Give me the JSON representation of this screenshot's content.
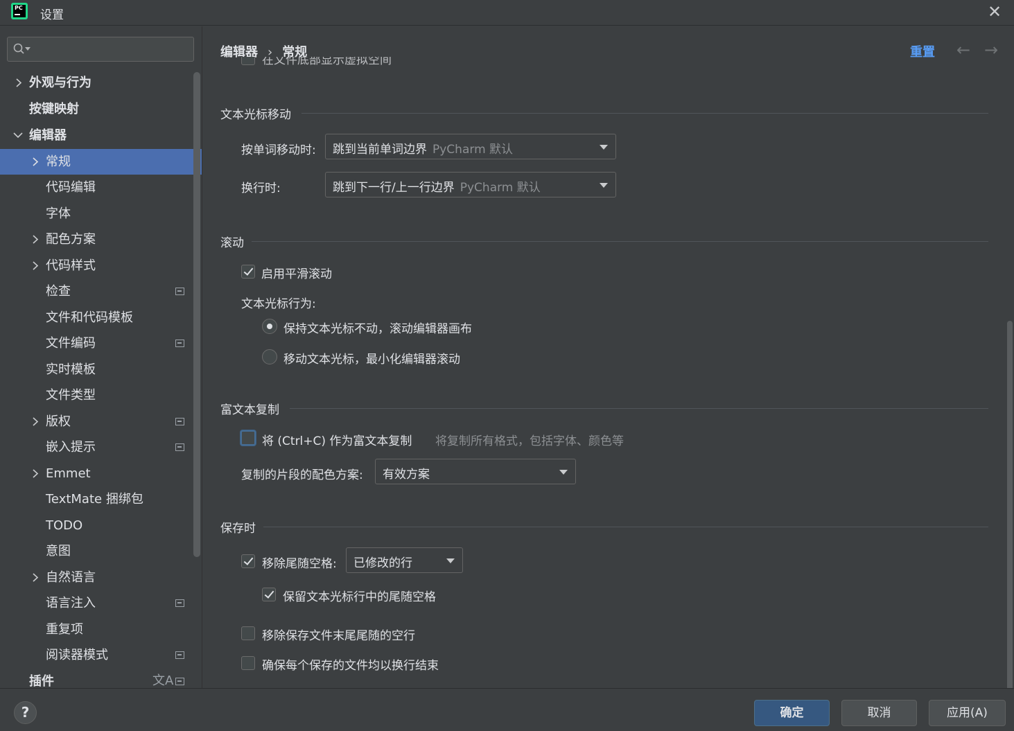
{
  "window": {
    "title": "设置",
    "close_glyph": "✕"
  },
  "sidebar": {
    "search": {
      "placeholder": ""
    },
    "items": [
      {
        "label": "外观与行为",
        "expanded": false,
        "bold": true
      },
      {
        "label": "按键映射",
        "bold": true
      },
      {
        "label": "编辑器",
        "expanded": true,
        "bold": true
      },
      {
        "label": "常规",
        "selected": true
      },
      {
        "label": "代码编辑"
      },
      {
        "label": "字体"
      },
      {
        "label": "配色方案"
      },
      {
        "label": "代码样式"
      },
      {
        "label": "检查"
      },
      {
        "label": "文件和代码模板"
      },
      {
        "label": "文件编码"
      },
      {
        "label": "实时模板"
      },
      {
        "label": "文件类型"
      },
      {
        "label": "版权"
      },
      {
        "label": "嵌入提示"
      },
      {
        "label": "Emmet"
      },
      {
        "label": "TextMate 捆绑包"
      },
      {
        "label": "TODO"
      },
      {
        "label": "意图"
      },
      {
        "label": "自然语言"
      },
      {
        "label": "语言注入"
      },
      {
        "label": "重复项"
      },
      {
        "label": "阅读器模式"
      },
      {
        "label": "插件",
        "bold": true
      }
    ]
  },
  "header": {
    "breadcrumb": [
      "编辑器",
      "常规"
    ],
    "breadcrumb_sep": "›",
    "reset_label": "重置",
    "back_glyph": "←",
    "forward_glyph": "→"
  },
  "partial_row_text": "在文件底部显示虚拟空间",
  "caret_movement": {
    "title": "文本光标移动",
    "word_label": "按单词移动时:",
    "word_value": "跳到当前单词边界",
    "word_hint": "PyCharm 默认",
    "line_label": "换行时:",
    "line_value": "跳到下一行/上一行边界",
    "line_hint": "PyCharm 默认"
  },
  "scrolling": {
    "title": "滚动",
    "smooth_label": "启用平滑滚动",
    "smooth_checked": true,
    "caret_behavior_label": "文本光标行为:",
    "radio1": "保持文本光标不动，滚动编辑器画布",
    "radio2": "移动文本光标，最小化编辑器滚动"
  },
  "rich_copy": {
    "title": "富文本复制",
    "copy_label": "将 (Ctrl+C) 作为富文本复制",
    "copy_hint": "将复制所有格式，包括字体、颜色等",
    "scheme_label": "复制的片段的配色方案:",
    "scheme_value": "有效方案"
  },
  "on_save": {
    "title": "保存时",
    "trailing_label": "移除尾随空格:",
    "trailing_value": "已修改的行",
    "keep_caret_label": "保留文本光标行中的尾随空格",
    "remove_blank_label": "移除保存文件末尾尾随的空行",
    "ensure_newline_label": "确保每个保存的文件均以换行结束"
  },
  "footer": {
    "help": "?",
    "ok": "确定",
    "cancel": "取消",
    "apply": "应用(A)"
  },
  "colors": {
    "accent": "#4b6eaf",
    "link": "#589df6",
    "background": "#3c3f41",
    "primary_button": "#365880"
  }
}
